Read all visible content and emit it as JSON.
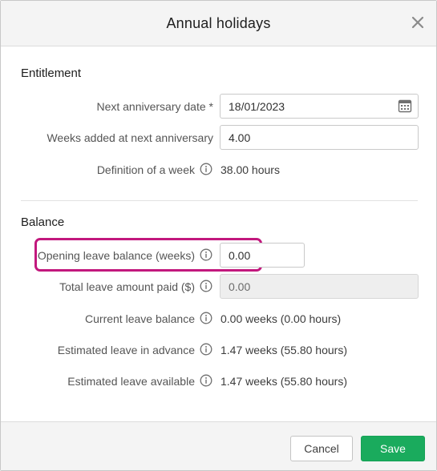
{
  "dialog": {
    "title": "Annual holidays"
  },
  "entitlement": {
    "heading": "Entitlement",
    "next_anniversary_label": "Next anniversary date *",
    "next_anniversary_value": "18/01/2023",
    "weeks_added_label": "Weeks added at next anniversary",
    "weeks_added_value": "4.00",
    "definition_label": "Definition of a week",
    "definition_value": "38.00 hours"
  },
  "balance": {
    "heading": "Balance",
    "opening_label": "Opening leave balance (weeks)",
    "opening_value": "0.00",
    "total_paid_label": "Total leave amount paid ($)",
    "total_paid_value": "0.00",
    "current_label": "Current leave balance",
    "current_value": "0.00 weeks (0.00 hours)",
    "advance_label": "Estimated leave in advance",
    "advance_value": "1.47 weeks (55.80 hours)",
    "available_label": "Estimated leave available",
    "available_value": "1.47 weeks (55.80 hours)"
  },
  "footer": {
    "cancel_label": "Cancel",
    "save_label": "Save"
  },
  "colors": {
    "highlight": "#c2187d",
    "save_button": "#1aab5d",
    "header_bg": "#f4f4f4"
  },
  "icons": [
    "close-icon",
    "calendar-icon",
    "info-icon"
  ]
}
